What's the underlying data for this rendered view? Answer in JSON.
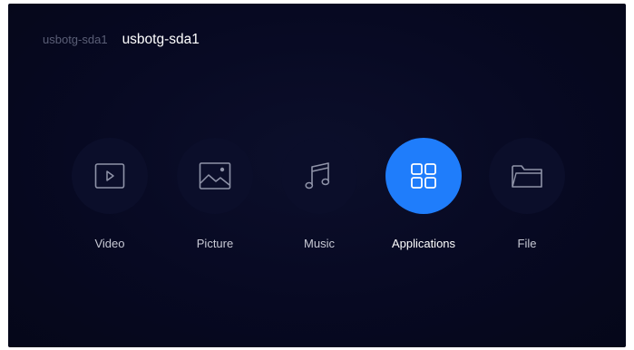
{
  "breadcrumb": {
    "previous": "usbotg-sda1",
    "current": "usbotg-sda1"
  },
  "categories": [
    {
      "label": "Video",
      "icon": "video-icon"
    },
    {
      "label": "Picture",
      "icon": "picture-icon"
    },
    {
      "label": "Music",
      "icon": "music-icon"
    },
    {
      "label": "Applications",
      "icon": "applications-icon",
      "selected": true
    },
    {
      "label": "File",
      "icon": "folder-icon"
    }
  ],
  "colors": {
    "background": "#070922",
    "accent": "#1f7dfb",
    "inactive_text": "#5a5e76"
  }
}
